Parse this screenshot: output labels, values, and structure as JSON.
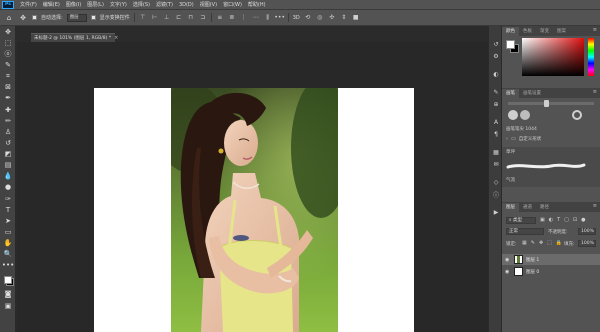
{
  "app": {
    "logo_text": "Ps"
  },
  "menu": [
    "文件(F)",
    "编辑(E)",
    "图像(I)",
    "图层(L)",
    "文字(Y)",
    "选择(S)",
    "滤镜(T)",
    "3D(D)",
    "视图(V)",
    "窗口(W)",
    "帮助(H)"
  ],
  "options_bar": {
    "auto_select_label": "自动选择:",
    "auto_select_value": "图层",
    "transform_label": "显示变换控件"
  },
  "document": {
    "tab_title": "未标题-2 @ 101% (图层 1, RGB/8) *",
    "tab_close": "×"
  },
  "color_panel": {
    "tabs": [
      "颜色",
      "色板",
      "渐变",
      "图案"
    ],
    "foreground": "#ffffff",
    "background": "#000000",
    "hue_top": "#ff2020"
  },
  "brush_panel": {
    "tabs": [
      "画笔",
      "画笔设置"
    ],
    "size_label": "画笔笔尖 1044",
    "folder_label": "自定义形状",
    "brush_name": "草坪",
    "flow_label": "气流"
  },
  "layers_panel": {
    "tabs": [
      "图层",
      "通道",
      "路径"
    ],
    "kind_label": "类型",
    "blend_mode": "正常",
    "opacity_label": "不透明度:",
    "opacity_value": "100%",
    "lock_label": "锁定:",
    "fill_label": "填充:",
    "fill_value": "100%",
    "layers": [
      {
        "name": "图层 1",
        "visible": true,
        "selected": true
      },
      {
        "name": "图层 0",
        "visible": true,
        "selected": false
      }
    ]
  }
}
